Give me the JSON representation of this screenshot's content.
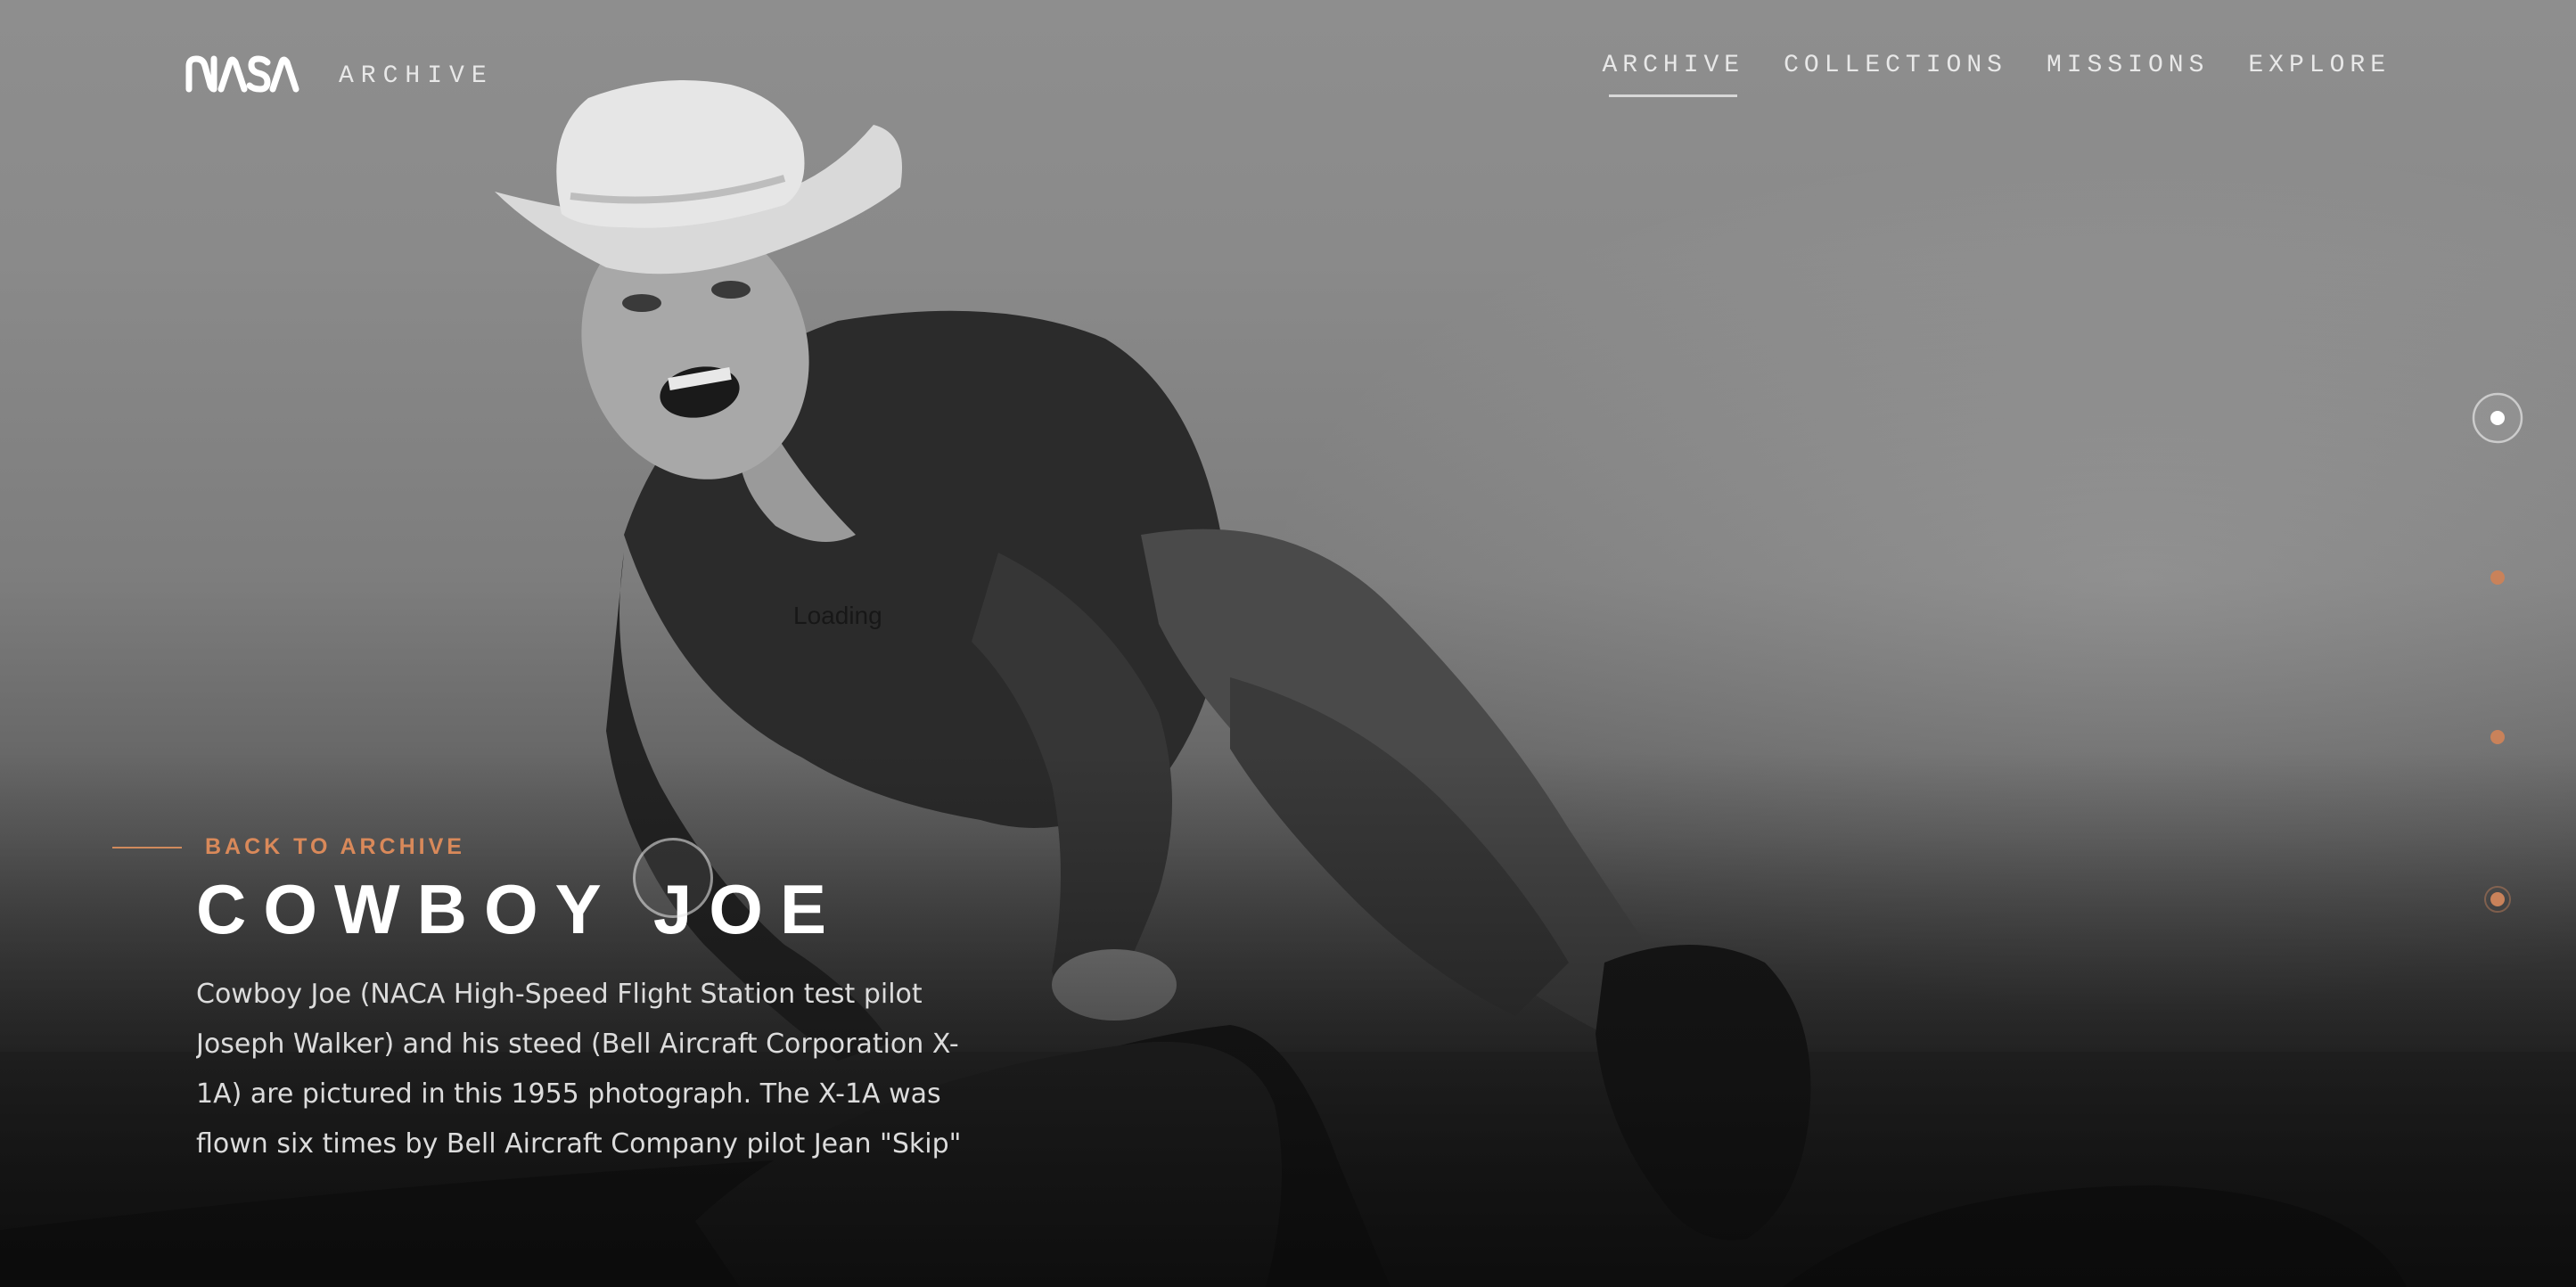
{
  "header": {
    "logo_text": "NASA",
    "logo_sub": "ARCHIVE"
  },
  "nav": {
    "items": [
      {
        "label": "ARCHIVE",
        "active": true
      },
      {
        "label": "COLLECTIONS",
        "active": false
      },
      {
        "label": "MISSIONS",
        "active": false
      },
      {
        "label": "EXPLORE",
        "active": false
      }
    ]
  },
  "pager": {
    "total": 4,
    "active_index": 0,
    "colors": {
      "active": "#ffffff",
      "inactive": "#c9825a"
    }
  },
  "hero": {
    "back_label": "BACK TO ARCHIVE",
    "title": "COWBOY JOE",
    "description": "Cowboy Joe (NACA High-Speed Flight Station test pilot Joseph Walker) and his steed (Bell Aircraft Corporation X-1A) are pictured in this 1955 photograph. The X-1A was flown six times by Bell Aircraft Company pilot Jean \"Skip\"",
    "ghost_text": "Loading"
  },
  "colors": {
    "accent": "#d9895a",
    "text": "#ffffff",
    "nav_text": "#e8e8e8"
  },
  "image": {
    "subject": "black-and-white photograph of a pilot in a cowboy hat climbing out of an aircraft cockpit"
  }
}
